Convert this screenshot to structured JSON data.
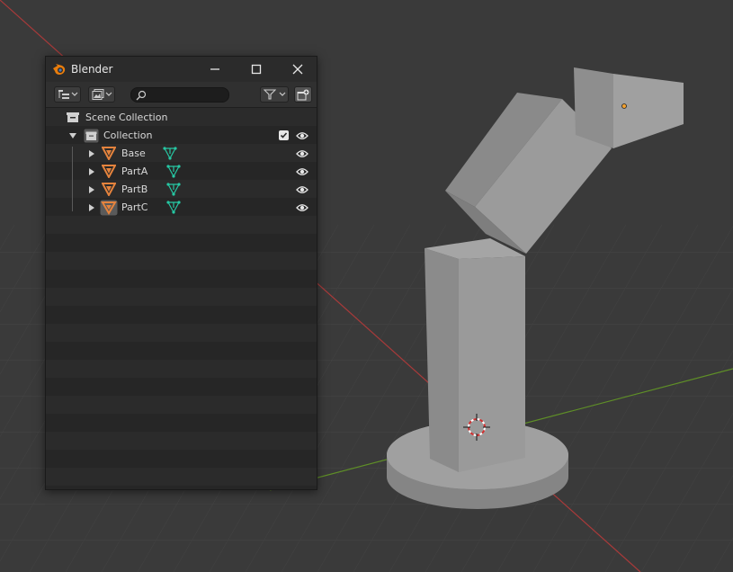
{
  "window": {
    "title": "Blender"
  },
  "outliner": {
    "search_value": "",
    "search_placeholder": "",
    "scene_collection_label": "Scene Collection",
    "collection_label": "Collection",
    "objects": [
      {
        "label": "Base"
      },
      {
        "label": "PartA"
      },
      {
        "label": "PartB"
      },
      {
        "label": "PartC"
      }
    ]
  },
  "icons": {
    "logo": "blender-logo-icon",
    "minimize": "minimize-icon",
    "maximize": "maximize-icon",
    "close": "close-icon",
    "display_mode": "outliner-display-mode-icon",
    "view_layer": "view-layer-icon",
    "search": "search-icon",
    "filter": "filter-funnel-icon",
    "new_collection": "new-collection-icon",
    "collection": "collection-box-icon",
    "object": "mesh-object-icon",
    "mesh_data": "mesh-data-icon",
    "visibility": "eye-icon",
    "exclude_checkbox": "checkbox-icon"
  },
  "colors": {
    "object_icon": "#e5833d",
    "mesh_data_icon": "#26c7a3",
    "viewport_bg": "#3a3a3a",
    "axis_x": "#a83a3a",
    "axis_y": "#5f8f27",
    "mesh_light": "#9a9a9a",
    "mesh_mid": "#868686",
    "mesh_dark": "#737373"
  }
}
